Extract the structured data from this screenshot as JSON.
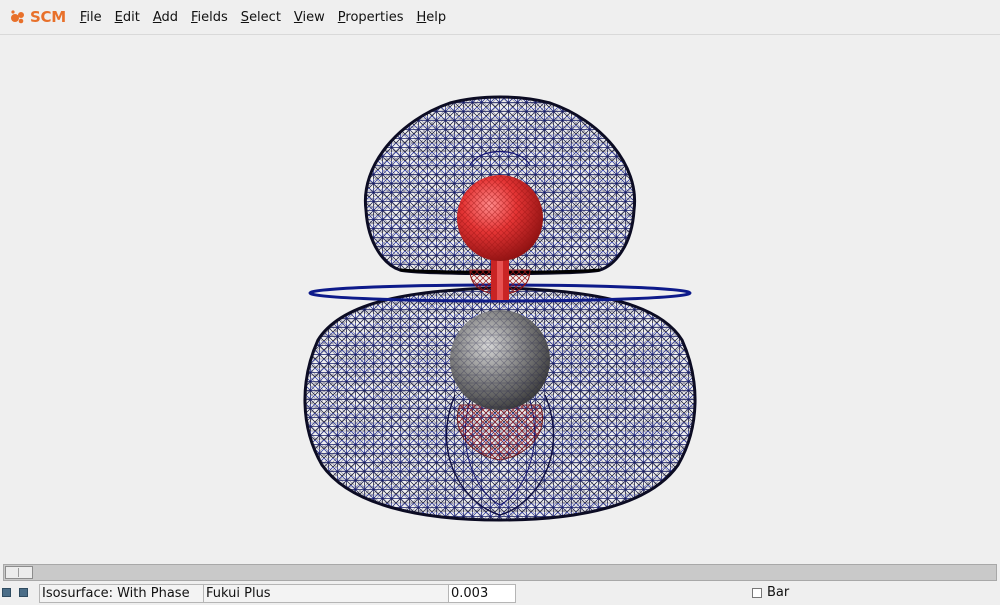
{
  "app": {
    "logo_text": "SCM",
    "logo_color": "#e8702a"
  },
  "menu": [
    {
      "label": "File",
      "accel": "F",
      "rest": "ile"
    },
    {
      "label": "Edit",
      "accel": "E",
      "rest": "dit"
    },
    {
      "label": "Add",
      "accel": "A",
      "rest": "dd"
    },
    {
      "label": "Fields",
      "accel": "F",
      "rest": "ields"
    },
    {
      "label": "Select",
      "accel": "S",
      "rest": "elect"
    },
    {
      "label": "View",
      "accel": "V",
      "rest": "iew"
    },
    {
      "label": "Properties",
      "accel": "P",
      "rest": "roperties"
    },
    {
      "label": "Help",
      "accel": "H",
      "rest": "elp"
    }
  ],
  "viewport": {
    "molecule": "diatomic",
    "atoms": [
      {
        "element": "O",
        "color": "#e03030"
      },
      {
        "element": "C",
        "color": "#8a8a8a"
      }
    ],
    "isosurface_colors": {
      "positive": "#1e2aa8",
      "negative": "#8a1515",
      "shadow": "#000000"
    }
  },
  "status": {
    "isosurface_mode": "Isosurface: With Phase",
    "field_name": "Fukui Plus",
    "iso_value": "0.003",
    "bar_label": "Bar",
    "bar_checked": false
  }
}
